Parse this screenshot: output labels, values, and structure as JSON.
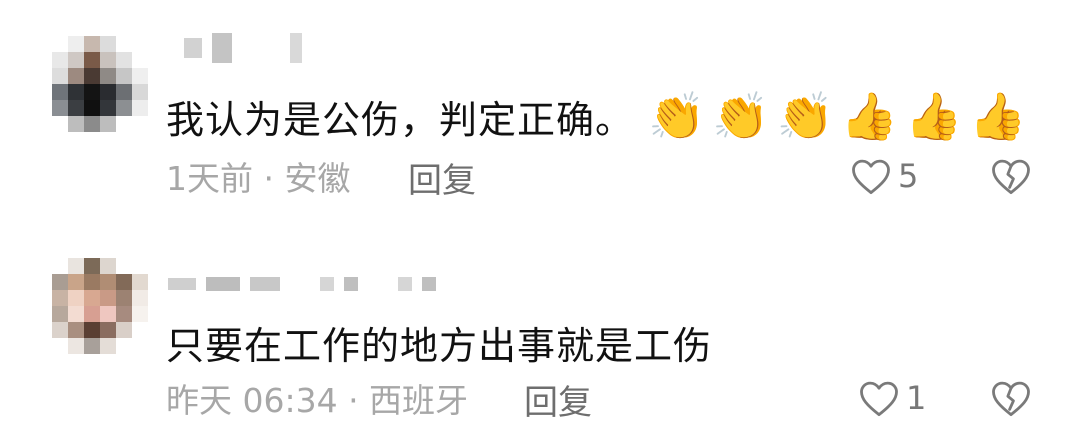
{
  "comments": [
    {
      "text": "我认为是公伤，判定正确。",
      "emojis": [
        "👏",
        "👏",
        "👏",
        "👍",
        "👍",
        "👍"
      ],
      "time_location": "1天前 · 安徽",
      "reply_label": "回复",
      "like_count": "5"
    },
    {
      "text": "只要在工作的地方出事就是工伤",
      "time_location": "昨天 06:34 · 西班牙",
      "reply_label": "回复",
      "like_count": "1"
    }
  ],
  "icons": {
    "like": "heart-outline-icon",
    "dislike": "broken-heart-outline-icon"
  }
}
